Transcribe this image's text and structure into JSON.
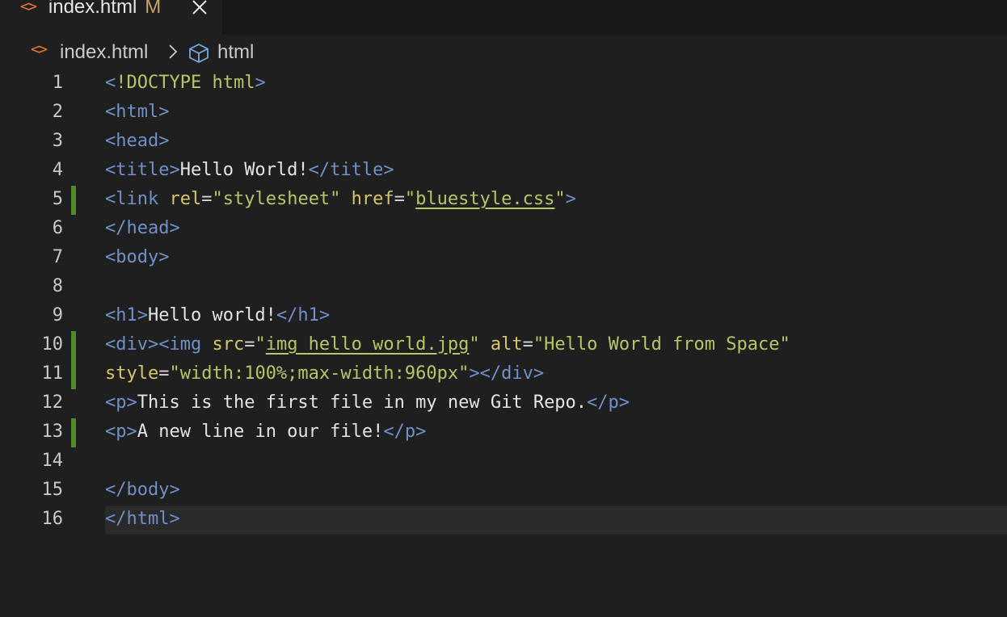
{
  "tab": {
    "icon": "html-file-icon",
    "title": "index.html",
    "modified": "M",
    "close_icon": "close-icon"
  },
  "breadcrumb": {
    "file_icon": "html-file-icon",
    "file": "index.html",
    "separator_icon": "chevron-right-icon",
    "element_icon": "cube-icon",
    "element": "html"
  },
  "colors": {
    "tag": "#6f90c8",
    "text": "#e4e4e4",
    "attribute": "#d6c56a",
    "string": "#b9c466",
    "gutter_modified": "#4f8a2c",
    "file_icon": "#e37933"
  },
  "editor": {
    "lines": [
      {
        "number": "1",
        "modified": false,
        "current": false,
        "tokens": [
          {
            "type": "tag",
            "text": "<"
          },
          {
            "type": "str",
            "text": "!DOCTYPE html"
          },
          {
            "type": "tag",
            "text": ">"
          }
        ]
      },
      {
        "number": "2",
        "modified": false,
        "current": false,
        "tokens": [
          {
            "type": "tag",
            "text": "<html>"
          }
        ]
      },
      {
        "number": "3",
        "modified": false,
        "current": false,
        "tokens": [
          {
            "type": "tag",
            "text": "<head>"
          }
        ]
      },
      {
        "number": "4",
        "modified": false,
        "current": false,
        "tokens": [
          {
            "type": "tag",
            "text": "<title>"
          },
          {
            "type": "text",
            "text": "Hello World!"
          },
          {
            "type": "tag",
            "text": "</title>"
          }
        ]
      },
      {
        "number": "5",
        "modified": true,
        "current": false,
        "tokens": [
          {
            "type": "tag",
            "text": "<link "
          },
          {
            "type": "attr",
            "text": "rel"
          },
          {
            "type": "eq",
            "text": "="
          },
          {
            "type": "str",
            "text": "\"stylesheet\" "
          },
          {
            "type": "attr",
            "text": "href"
          },
          {
            "type": "eq",
            "text": "="
          },
          {
            "type": "str",
            "text": "\""
          },
          {
            "type": "link",
            "text": "bluestyle.css"
          },
          {
            "type": "str",
            "text": "\""
          },
          {
            "type": "tag",
            "text": ">"
          }
        ]
      },
      {
        "number": "6",
        "modified": false,
        "current": false,
        "tokens": [
          {
            "type": "tag",
            "text": "</head>"
          }
        ]
      },
      {
        "number": "7",
        "modified": false,
        "current": false,
        "tokens": [
          {
            "type": "tag",
            "text": "<body>"
          }
        ]
      },
      {
        "number": "8",
        "modified": false,
        "current": false,
        "tokens": []
      },
      {
        "number": "9",
        "modified": false,
        "current": false,
        "tokens": [
          {
            "type": "tag",
            "text": "<h1>"
          },
          {
            "type": "text",
            "text": "Hello world!"
          },
          {
            "type": "tag",
            "text": "</h1>"
          }
        ]
      },
      {
        "number": "10",
        "modified": true,
        "current": false,
        "tokens": [
          {
            "type": "tag",
            "text": "<div><img "
          },
          {
            "type": "attr",
            "text": "src"
          },
          {
            "type": "eq",
            "text": "="
          },
          {
            "type": "str",
            "text": "\""
          },
          {
            "type": "link",
            "text": "img_hello_world.jpg"
          },
          {
            "type": "str",
            "text": "\" "
          },
          {
            "type": "attr",
            "text": "alt"
          },
          {
            "type": "eq",
            "text": "="
          },
          {
            "type": "str",
            "text": "\"Hello World from Space\""
          }
        ]
      },
      {
        "number": "11",
        "modified": true,
        "current": false,
        "tokens": [
          {
            "type": "attr",
            "text": "style"
          },
          {
            "type": "eq",
            "text": "="
          },
          {
            "type": "str",
            "text": "\"width:100%;max-width:960px\""
          },
          {
            "type": "tag",
            "text": "></div>"
          }
        ]
      },
      {
        "number": "12",
        "modified": false,
        "current": false,
        "tokens": [
          {
            "type": "tag",
            "text": "<p>"
          },
          {
            "type": "text",
            "text": "This is the first file in my new Git Repo."
          },
          {
            "type": "tag",
            "text": "</p>"
          }
        ]
      },
      {
        "number": "13",
        "modified": true,
        "current": false,
        "tokens": [
          {
            "type": "tag",
            "text": "<p>"
          },
          {
            "type": "text",
            "text": "A new line in our file!"
          },
          {
            "type": "tag",
            "text": "</p>"
          }
        ]
      },
      {
        "number": "14",
        "modified": false,
        "current": false,
        "tokens": []
      },
      {
        "number": "15",
        "modified": false,
        "current": false,
        "tokens": [
          {
            "type": "tag",
            "text": "</body>"
          }
        ]
      },
      {
        "number": "16",
        "modified": false,
        "current": true,
        "tokens": [
          {
            "type": "tag",
            "text": "</html>"
          }
        ]
      }
    ]
  }
}
